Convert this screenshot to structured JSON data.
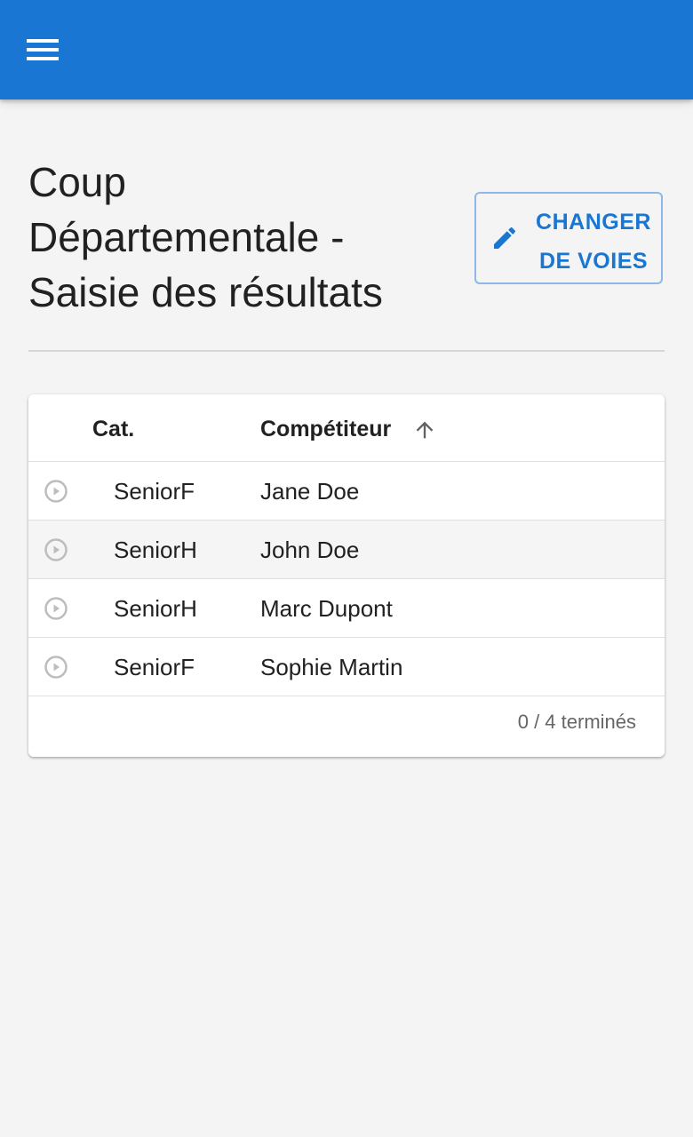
{
  "colors": {
    "app_bar": "#1976d2",
    "accent": "#1976d2",
    "background": "#f4f4f4"
  },
  "header": {
    "menu_icon": "hamburger-menu-icon"
  },
  "page": {
    "title_line1": "Coup",
    "title_line2": "Départementale -",
    "title_line3": "Saisie des résultats"
  },
  "actions": {
    "change_lanes_line1": "CHANGER",
    "change_lanes_line2": "DE VOIES",
    "change_lanes_icon": "pencil-icon"
  },
  "table": {
    "columns": [
      "Cat.",
      "Compétiteur"
    ],
    "sort_icon": "arrow-up-icon",
    "rows": [
      {
        "category": "SeniorF",
        "competitor": "Jane Doe",
        "icon": "play-circle-icon"
      },
      {
        "category": "SeniorH",
        "competitor": "John Doe",
        "icon": "play-circle-icon"
      },
      {
        "category": "SeniorH",
        "competitor": "Marc Dupont",
        "icon": "play-circle-icon"
      },
      {
        "category": "SeniorF",
        "competitor": "Sophie Martin",
        "icon": "play-circle-icon"
      }
    ],
    "status": "0 / 4 terminés"
  }
}
